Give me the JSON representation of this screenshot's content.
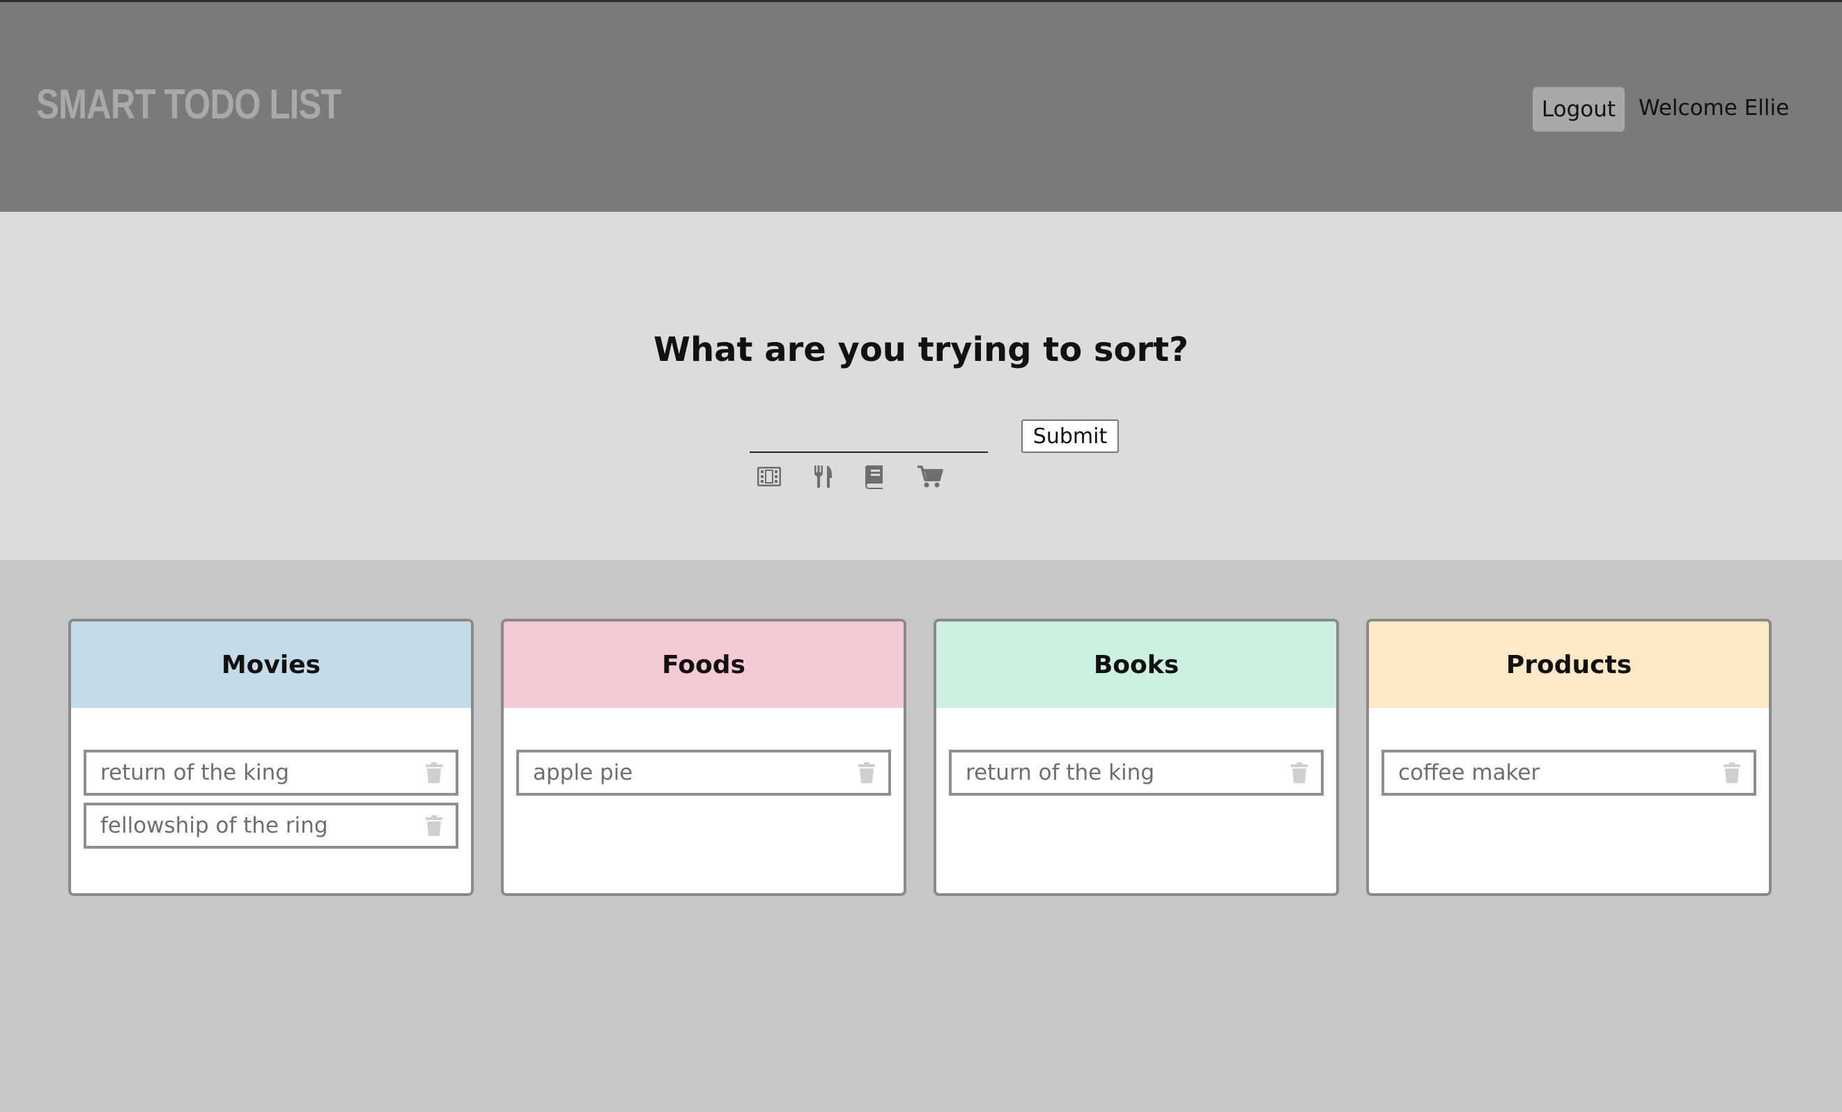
{
  "app": {
    "title": "SMART TODO LIST"
  },
  "header": {
    "logout_label": "Logout",
    "welcome_text": "Welcome Ellie"
  },
  "sorter": {
    "heading": "What are you trying to sort?",
    "input_value": "",
    "input_placeholder": "",
    "submit_label": "Submit",
    "category_icons": [
      "film-icon",
      "utensils-icon",
      "book-icon",
      "shopping-cart-icon"
    ]
  },
  "categories": [
    {
      "title": "Movies",
      "color": "#c5dbe7",
      "items": [
        "return of the king",
        "fellowship of the ring"
      ]
    },
    {
      "title": "Foods",
      "color": "#f4cbd4",
      "items": [
        "apple pie"
      ]
    },
    {
      "title": "Books",
      "color": "#cdf0e1",
      "items": [
        "return of the king"
      ]
    },
    {
      "title": "Products",
      "color": "#fde9c6",
      "items": [
        "coffee maker"
      ]
    }
  ],
  "colors": {
    "topbar": "#7a7a7a",
    "hero": "#dcdcdc",
    "board": "#c7c7c7",
    "icon": "#6e6e6e",
    "trash": "#cfcfcf"
  }
}
